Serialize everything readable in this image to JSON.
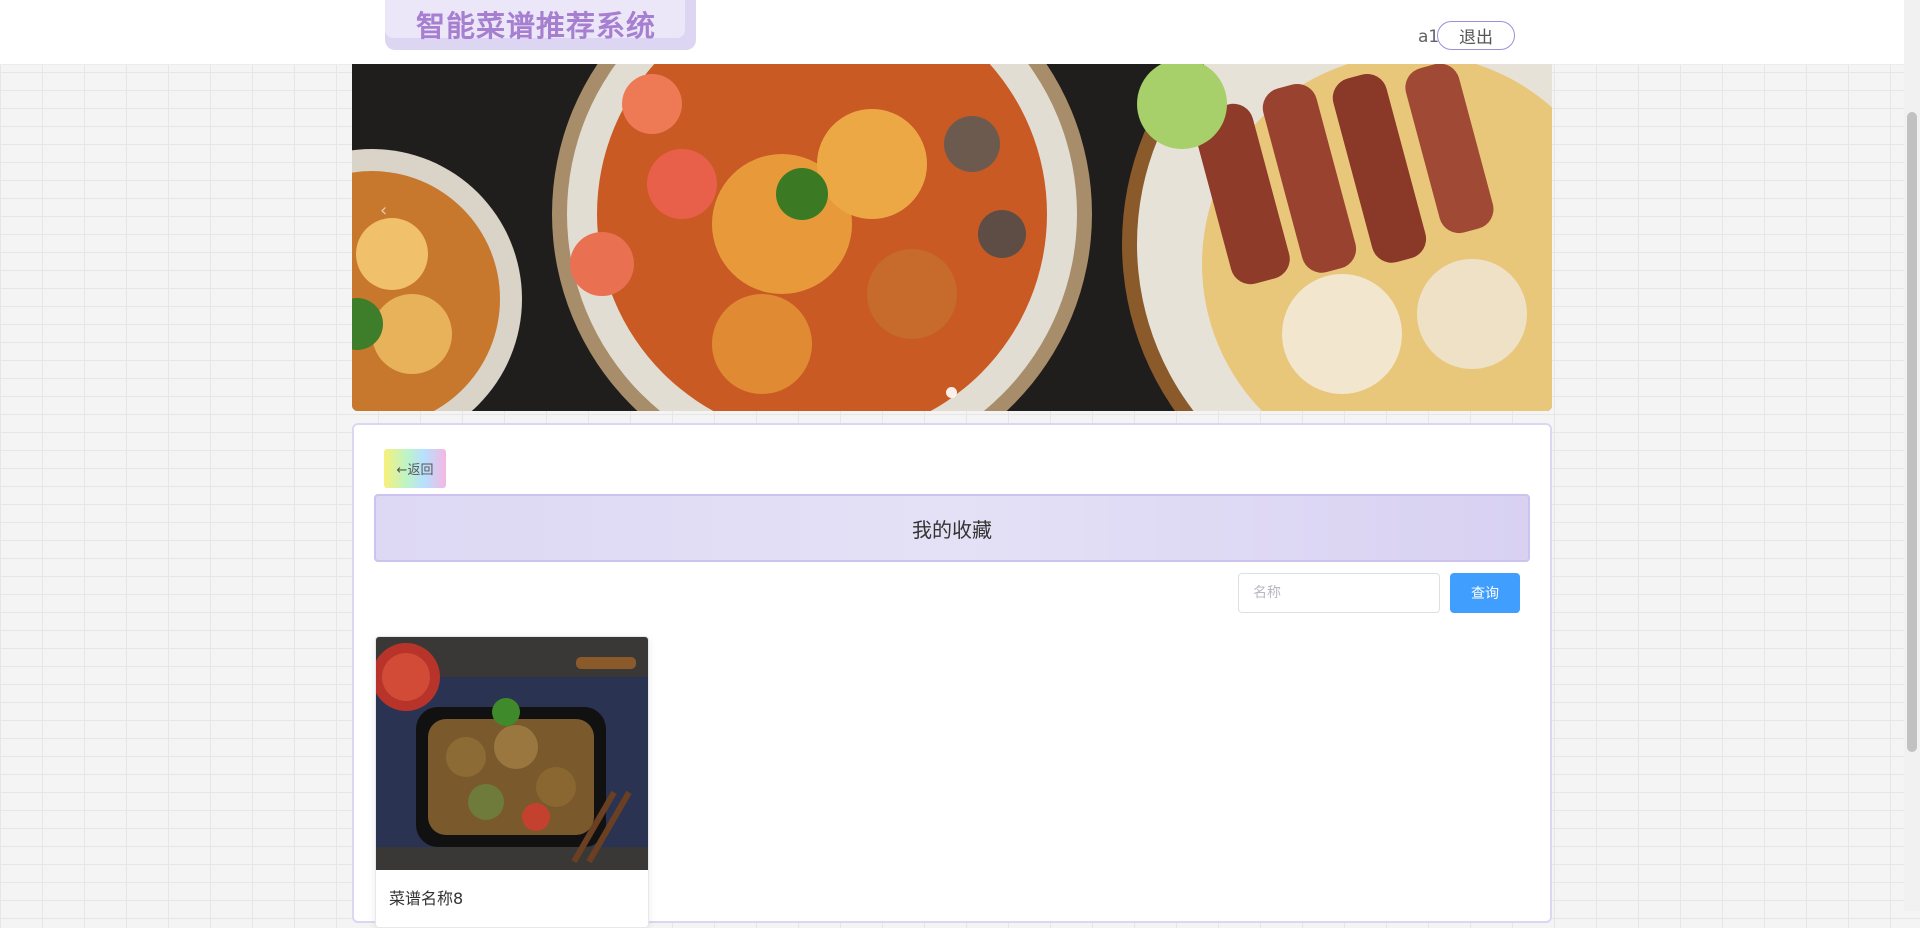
{
  "header": {
    "app_title": "智能菜谱推荐系统",
    "username": "a1",
    "logout_label": "退出"
  },
  "banner": {
    "prev_arrow": "‹",
    "indicator_count": 1,
    "active_indicator": 1
  },
  "content": {
    "back_label": "←返回",
    "page_title": "我的收藏",
    "search": {
      "placeholder": "名称",
      "value": "",
      "button_label": "查询"
    },
    "recipes": [
      {
        "name": "菜谱名称8"
      }
    ]
  },
  "colors": {
    "accent": "#a77fd1",
    "primary_button": "#409eff",
    "title_bar": "#ddd8f4"
  }
}
